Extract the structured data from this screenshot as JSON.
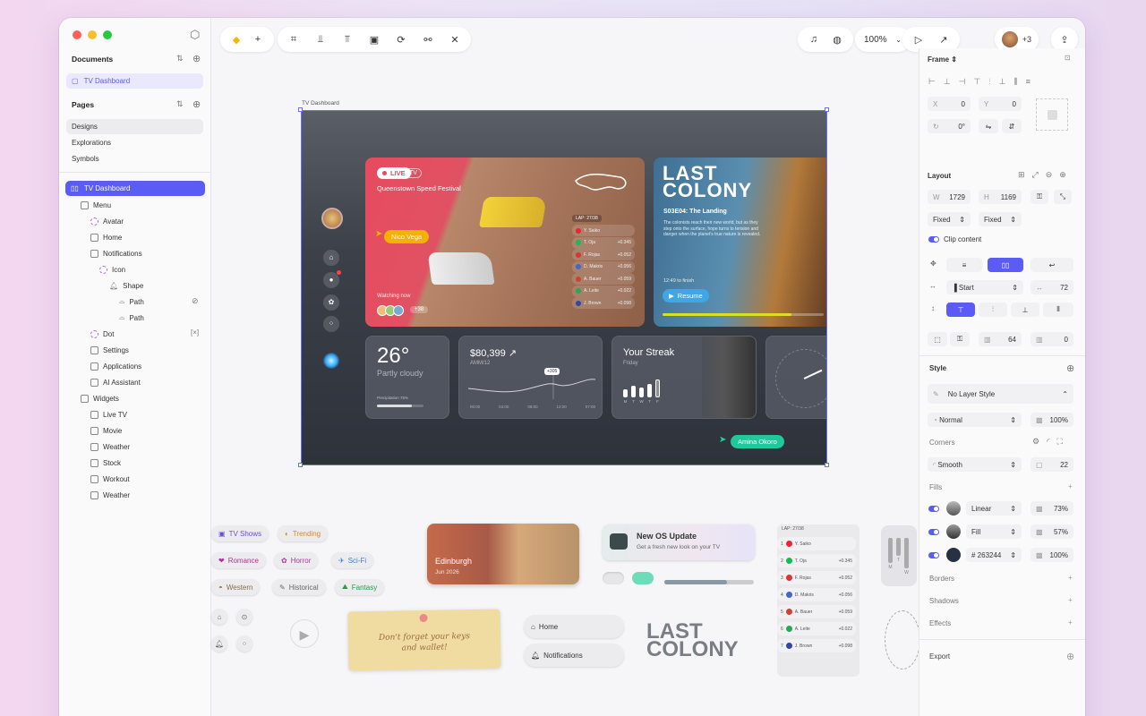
{
  "toolbar": {
    "zoom": "100%",
    "collaborators": "+3"
  },
  "sidebar": {
    "documents_title": "Documents",
    "current_document": "TV Dashboard",
    "pages_title": "Pages",
    "pages": [
      "Designs",
      "Explorations",
      "Symbols"
    ],
    "layers": [
      "TV Dashboard",
      "Menu",
      "Avatar",
      "Home",
      "Notifications",
      "Icon",
      "Shape",
      "Path",
      "Path",
      "Dot",
      "Settings",
      "Applications",
      "AI Assistant",
      "Widgets",
      "Live TV",
      "Movie",
      "Weather",
      "Stock",
      "Workout",
      "Weather"
    ]
  },
  "canvas": {
    "frame_label": "TV Dashboard",
    "live": {
      "badge": "LIVE",
      "tv": "TV",
      "title": "Queenstown Speed Festival",
      "user": "Nico Vega",
      "watching": "Watching now",
      "extra": "+38",
      "lap": "LAP: 27/38"
    },
    "drivers": [
      [
        "Y. Saiko",
        ""
      ],
      [
        "T. Oja",
        "+0.345"
      ],
      [
        "F. Rojas",
        "+0.052"
      ],
      [
        "D. Makris",
        "+0.056"
      ],
      [
        "A. Bauer",
        "+0.059"
      ],
      [
        "A. Leite",
        "+0.022"
      ],
      [
        "J. Brown",
        "+0.098"
      ]
    ],
    "movie": {
      "title_l1": "LAST",
      "title_l2": "COLONY",
      "episode": "S03E04: The Landing",
      "desc": "The colonists reach their new world, but as they step onto the surface, hope turns to tension and danger when the planet's true nature is revealed.",
      "time_left": "12:49 to finish",
      "resume": "Resume"
    },
    "weather": {
      "temp": "26°",
      "condition": "Partly cloudy",
      "precip": "Precipitation 75%"
    },
    "stock": {
      "value": "$80,399 ↗",
      "ticker": "AMM/12",
      "marker": "+305",
      "times": [
        "00:00",
        "04:00",
        "08:00",
        "12:00",
        "07:00"
      ]
    },
    "streak": {
      "title": "Your Streak",
      "day": "Friday",
      "days": [
        "M",
        "T",
        "W",
        "T",
        "F"
      ],
      "bars": [
        0.4,
        0.6,
        0.5,
        0.7,
        0.9
      ]
    },
    "cursor_user": "Amina Okoro"
  },
  "bottom": {
    "chips": [
      "TV Shows",
      "Trending",
      "Romance",
      "Horror",
      "Sci-Fi",
      "Western",
      "Historical",
      "Fantasy"
    ],
    "place": {
      "name": "Edinburgh",
      "date": "Jun 2026"
    },
    "update": {
      "title": "New OS Update",
      "sub": "Get a fresh new look on your TV"
    },
    "note": "Don't forget your keys and wallet!",
    "nav": [
      "Home",
      "Notifications"
    ],
    "logo_l1": "LAST",
    "logo_l2": "COLONY",
    "lap": "LAP: 27/38",
    "drivers": [
      [
        "1",
        "Y. Saiko",
        ""
      ],
      [
        "2",
        "T. Oja",
        "+0.345"
      ],
      [
        "3",
        "F. Rojas",
        "+0.052"
      ],
      [
        "4",
        "D. Makris",
        "+0.056"
      ],
      [
        "5",
        "A. Bauer",
        "+0.059"
      ],
      [
        "6",
        "A. Leite",
        "+0.022"
      ],
      [
        "7",
        "J. Brown",
        "+0.098"
      ]
    ],
    "bar_days": [
      "M",
      "T",
      "W"
    ]
  },
  "inspector": {
    "frame": "Frame",
    "x": "X",
    "x_val": "0",
    "y": "Y",
    "y_val": "0",
    "rot": "0°",
    "layout": "Layout",
    "w": "W",
    "w_val": "1729",
    "h": "H",
    "h_val": "1169",
    "fixed1": "Fixed",
    "fixed2": "Fixed",
    "clip": "Clip content",
    "align": "Start",
    "gap": "72",
    "pad": "64",
    "pad2": "0",
    "style": "Style",
    "layer_style": "No Layer Style",
    "blend": "Normal",
    "opacity": "100%",
    "corners": "Corners",
    "smoothing": "Smooth",
    "radius": "22",
    "fills": "Fills",
    "fill_rows": [
      {
        "type": "Linear",
        "opacity": "73%"
      },
      {
        "type": "Fill",
        "opacity": "57%"
      },
      {
        "type": "# 263244",
        "opacity": "100%"
      }
    ],
    "borders": "Borders",
    "shadows": "Shadows",
    "effects": "Effects",
    "export": "Export"
  },
  "colors": {
    "accent": "#5b5bf5",
    "live_red": "#e94a5a",
    "teal": "#2fc9a0"
  }
}
